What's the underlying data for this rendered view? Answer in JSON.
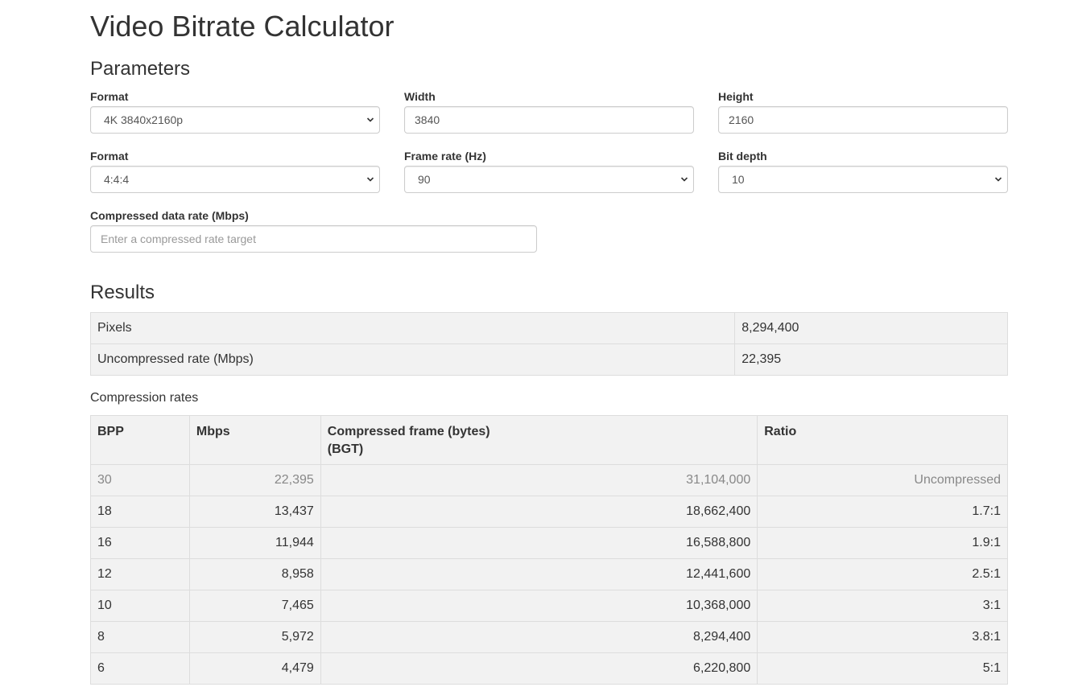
{
  "page": {
    "title": "Video Bitrate Calculator"
  },
  "parameters": {
    "heading": "Parameters",
    "format": {
      "label": "Format",
      "value": "4K 3840x2160p"
    },
    "width": {
      "label": "Width",
      "value": "3840"
    },
    "height": {
      "label": "Height",
      "value": "2160"
    },
    "chroma": {
      "label": "Format",
      "value": "4:4:4"
    },
    "frame_rate": {
      "label": "Frame rate (Hz)",
      "value": "90"
    },
    "bit_depth": {
      "label": "Bit depth",
      "value": "10"
    },
    "compressed_rate": {
      "label": "Compressed data rate (Mbps)",
      "placeholder": "Enter a compressed rate target",
      "value": ""
    }
  },
  "results": {
    "heading": "Results",
    "rows": [
      {
        "label": "Pixels",
        "value": "8,294,400"
      },
      {
        "label": "Uncompressed rate (Mbps)",
        "value": "22,395"
      }
    ]
  },
  "compression": {
    "caption": "Compression rates",
    "headers": {
      "bpp": "BPP",
      "mbps": "Mbps",
      "frame_line1": "Compressed frame (bytes)",
      "frame_line2": "(BGT)",
      "ratio": "Ratio"
    },
    "rows": [
      {
        "bpp": "30",
        "mbps": "22,395",
        "frame": "31,104,000",
        "ratio": "Uncompressed"
      },
      {
        "bpp": "18",
        "mbps": "13,437",
        "frame": "18,662,400",
        "ratio": "1.7:1"
      },
      {
        "bpp": "16",
        "mbps": "11,944",
        "frame": "16,588,800",
        "ratio": "1.9:1"
      },
      {
        "bpp": "12",
        "mbps": "8,958",
        "frame": "12,441,600",
        "ratio": "2.5:1"
      },
      {
        "bpp": "10",
        "mbps": "7,465",
        "frame": "10,368,000",
        "ratio": "3:1"
      },
      {
        "bpp": "8",
        "mbps": "5,972",
        "frame": "8,294,400",
        "ratio": "3.8:1"
      },
      {
        "bpp": "6",
        "mbps": "4,479",
        "frame": "6,220,800",
        "ratio": "5:1"
      }
    ]
  }
}
